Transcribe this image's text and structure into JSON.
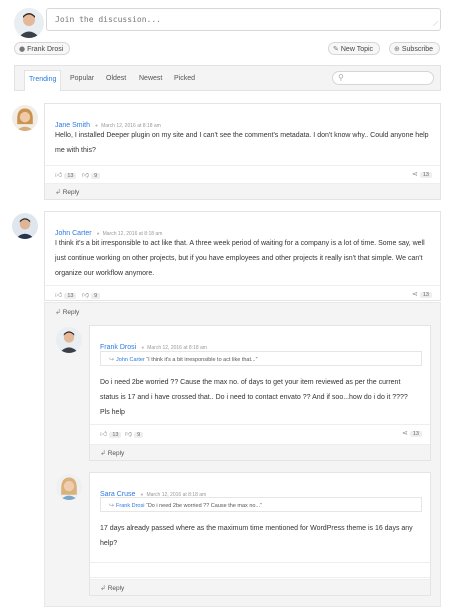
{
  "composer": {
    "placeholder": "Join the discussion...",
    "user": "Frank Drosi",
    "new_topic": "New Topic",
    "subscribe": "Subscribe"
  },
  "tabs": [
    {
      "label": "Trending",
      "active": true
    },
    {
      "label": "Popular",
      "active": false
    },
    {
      "label": "Oldest",
      "active": false
    },
    {
      "label": "Newest",
      "active": false
    },
    {
      "label": "Picked",
      "active": false
    }
  ],
  "comments": [
    {
      "name": "Jane Smith",
      "time": "March 12, 2016 at 8:18 am",
      "body": "Hello, I installed Deeper plugin on my site and I can't see the comment's metadata. I don't know why.. Could anyone help me with this?",
      "likes": "13",
      "dislikes": "9",
      "shares": "13",
      "reply": "Reply"
    },
    {
      "name": "John Carter",
      "time": "March 12, 2016 at 8:18 am",
      "body": "I think it's a bit irresponsible to act like that. A three week period of waiting for a company is a lot of time. Some say, well just continue working on other projects, but if you have employees and other projects it really isn't that simple. We can't organize our workflow anymore.",
      "likes": "13",
      "dislikes": "9",
      "shares": "13",
      "reply": "Reply"
    }
  ],
  "thread_reply_label": "Reply",
  "replies": [
    {
      "name": "Frank Drosi",
      "time": "March 12, 2016 at 8:18 am",
      "quote_name": "John Carter",
      "quote_text": "“I think it's a bit irresponsible to act like that...”",
      "body": "Do i need 2be worried ?? Cause the max no. of days to get your item reviewed as per the current status is 17 and i have crossed that.. Do i need to contact envato ?? And if soo...how do i do it ???? Pls help",
      "likes": "13",
      "dislikes": "9",
      "shares": "13",
      "reply": "Reply"
    },
    {
      "name": "Sara Cruse",
      "time": "March 12, 2016 at 8:18 am",
      "quote_name": "Frank Drosi",
      "quote_text": "“Do i need 2be worried ?? Cause the max no...”",
      "body": "17 days already passed where as the maximum time mentioned for WordPress theme is 16 days any help?",
      "likes": "",
      "dislikes": "",
      "shares": "",
      "reply": "Reply"
    }
  ]
}
